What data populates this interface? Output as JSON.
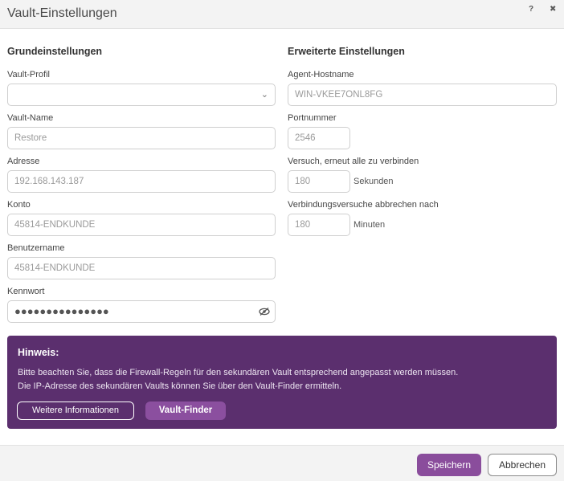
{
  "header": {
    "title": "Vault-Einstellungen",
    "help_glyph": "?",
    "close_glyph": "✖"
  },
  "basic": {
    "section_title": "Grundeinstellungen",
    "profile": {
      "label": "Vault-Profil",
      "value": ""
    },
    "name": {
      "label": "Vault-Name",
      "value": "Restore"
    },
    "address": {
      "label": "Adresse",
      "value": "192.168.143.187"
    },
    "account": {
      "label": "Konto",
      "value": "45814-ENDKUNDE"
    },
    "username": {
      "label": "Benutzername",
      "value": "45814-ENDKUNDE"
    },
    "password": {
      "label": "Kennwort",
      "masked": "●●●●●●●●●●●●●●●"
    }
  },
  "advanced": {
    "section_title": "Erweiterte Einstellungen",
    "hostname": {
      "label": "Agent-Hostname",
      "value": "WIN-VKEE7ONL8FG"
    },
    "port": {
      "label": "Portnummer",
      "value": "2546"
    },
    "retry": {
      "label": "Versuch, erneut alle zu verbinden",
      "value": "180",
      "unit": "Sekunden"
    },
    "abort": {
      "label": "Verbindungsversuche abbrechen nach",
      "value": "180",
      "unit": "Minuten"
    }
  },
  "notice": {
    "title": "Hinweis:",
    "line1": "Bitte beachten Sie, dass die Firewall-Regeln für den sekundären Vault entsprechend angepasst werden müssen.",
    "line2": "Die IP-Adresse des sekundären Vaults können Sie über den Vault-Finder ermitteln.",
    "more_info_label": "Weitere Informationen",
    "finder_label": "Vault-Finder"
  },
  "footer": {
    "save_label": "Speichern",
    "cancel_label": "Abbrechen"
  },
  "colors": {
    "accent": "#8a4d9c",
    "notice_bg": "#5b2f6e"
  }
}
